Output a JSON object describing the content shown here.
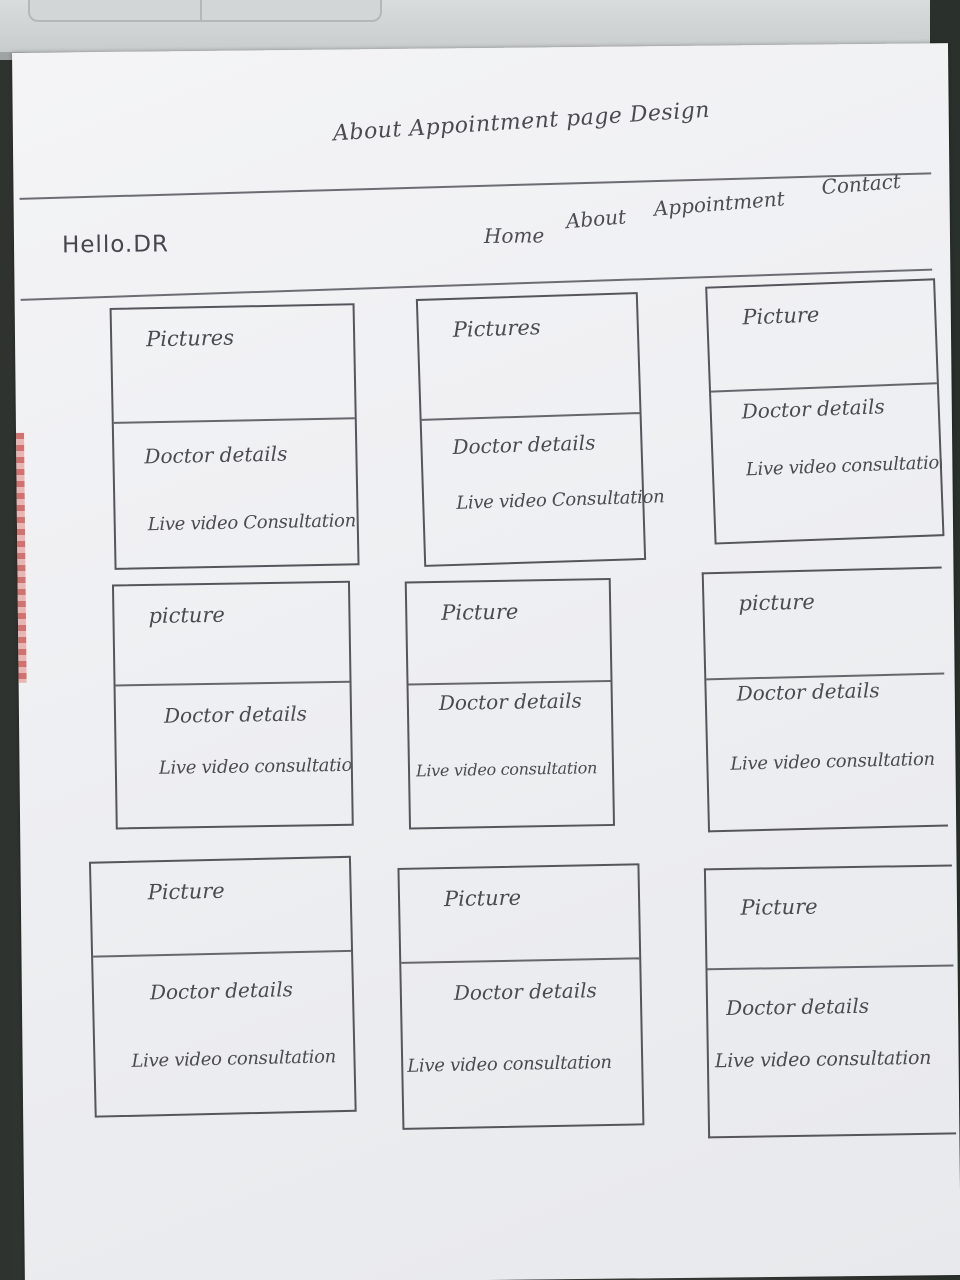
{
  "page_title": "About Appointment page Design",
  "header": {
    "logo": "Hello.DR",
    "nav": [
      "Home",
      "About",
      "Appointment",
      "Contact"
    ]
  },
  "cards": [
    {
      "picture": "Pictures",
      "details": "Doctor details",
      "video": "Live video Consultation"
    },
    {
      "picture": "Pictures",
      "details": "Doctor details",
      "video": "Live video Consultation"
    },
    {
      "picture": "Picture",
      "details": "Doctor details",
      "video": "Live video consultation"
    },
    {
      "picture": "picture",
      "details": "Doctor details",
      "video": "Live video consultation"
    },
    {
      "picture": "Picture",
      "details": "Doctor details",
      "video": "Live video consultation"
    },
    {
      "picture": "picture",
      "details": "Doctor details",
      "video": "Live video consultation"
    },
    {
      "picture": "Picture",
      "details": "Doctor details",
      "video": "Live video consultation"
    },
    {
      "picture": "Picture",
      "details": "Doctor details",
      "video": "Live video consultation"
    },
    {
      "picture": "Picture",
      "details": "Doctor details",
      "video": "Live video consultation"
    }
  ]
}
